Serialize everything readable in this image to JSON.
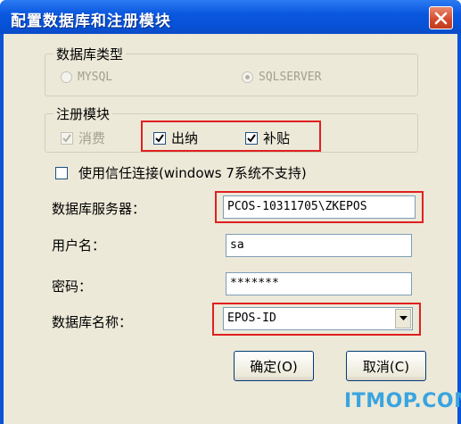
{
  "window": {
    "title": "配置数据库和注册模块"
  },
  "db_type": {
    "legend": "数据库类型",
    "options": [
      "MYSQL",
      "SQLSERVER"
    ],
    "selected": "SQLSERVER"
  },
  "modules": {
    "legend": "注册模块",
    "items": [
      {
        "label": "消费",
        "checked": true,
        "enabled": false
      },
      {
        "label": "出纳",
        "checked": true,
        "enabled": true
      },
      {
        "label": "补贴",
        "checked": true,
        "enabled": true
      }
    ]
  },
  "trust_connection": {
    "label": "使用信任连接(windows 7系统不支持)",
    "checked": false
  },
  "form": {
    "server_label": "数据库服务器：",
    "server_value": "PCOS-10311705\\ZKEPOS",
    "user_label": "用户名：",
    "user_value": "sa",
    "password_label": "密码：",
    "password_value": "*******",
    "dbname_label": "数据库名称：",
    "dbname_value": "EPOS-ID"
  },
  "buttons": {
    "ok": "确定(O)",
    "cancel": "取消(C)"
  },
  "watermark": "ITMOP.COM",
  "colors": {
    "title_bar": "#0a54d8",
    "client_bg": "#ece9d8",
    "highlight": "#e02020",
    "watermark": "#3aa4e0"
  }
}
